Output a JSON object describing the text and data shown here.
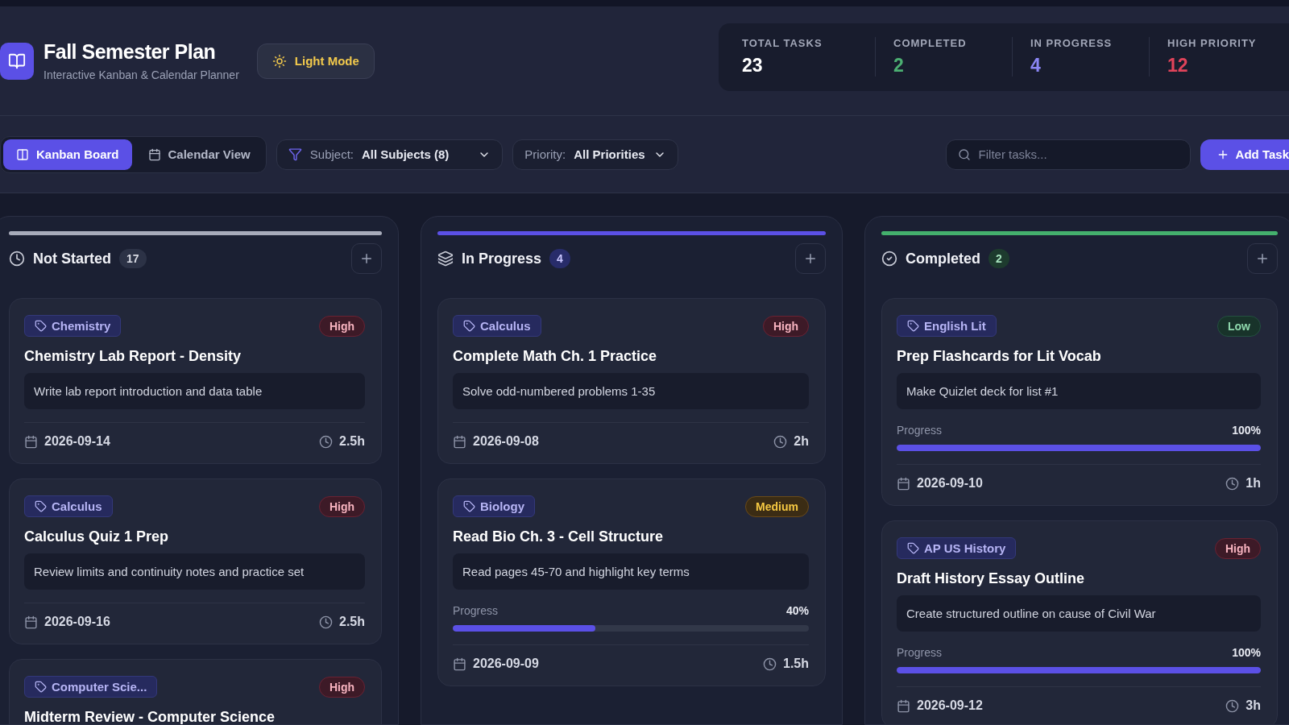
{
  "header": {
    "title": "Fall Semester Plan",
    "subtitle": "Interactive Kanban & Calendar Planner",
    "theme_button": "Light Mode"
  },
  "stats": [
    {
      "label": "TOTAL TASKS",
      "value": "23",
      "kind": "total"
    },
    {
      "label": "COMPLETED",
      "value": "2",
      "kind": "completed"
    },
    {
      "label": "IN PROGRESS",
      "value": "4",
      "kind": "progress"
    },
    {
      "label": "HIGH PRIORITY",
      "value": "12",
      "kind": "high"
    }
  ],
  "views": [
    {
      "label": "Kanban Board",
      "kind": "kanban",
      "selected": true
    },
    {
      "label": "Calendar View",
      "kind": "calendar",
      "selected": false
    }
  ],
  "filters": [
    {
      "label": "Subject:",
      "value": "All Subjects (8)",
      "kind": "subject"
    },
    {
      "label": "Priority:",
      "value": "All Priorities",
      "kind": "priority"
    }
  ],
  "search": {
    "placeholder": "Filter tasks..."
  },
  "add_button": "Add Task",
  "columns": [
    {
      "title": "Not Started",
      "count": "17",
      "kind": "not_started",
      "tasks": [
        {
          "subject": "Chemistry",
          "priority": "High",
          "kind": "high",
          "title": "Chemistry Lab Report - Density",
          "description": "Write lab report introduction and data table",
          "date": "2026-09-14",
          "duration": "2.5h"
        },
        {
          "subject": "Calculus",
          "priority": "High",
          "kind": "high",
          "title": "Calculus Quiz 1 Prep",
          "description": "Review limits and continuity notes and practice set",
          "date": "2026-09-16",
          "duration": "2.5h"
        },
        {
          "subject": "Computer Scie...",
          "priority": "High",
          "kind": "high",
          "title": "Midterm Review - Computer Science"
        }
      ]
    },
    {
      "title": "In Progress",
      "count": "4",
      "kind": "in_progress",
      "tasks": [
        {
          "subject": "Calculus",
          "priority": "High",
          "kind": "high",
          "title": "Complete Math Ch. 1 Practice",
          "description": "Solve odd-numbered problems 1-35",
          "date": "2026-09-08",
          "duration": "2h"
        },
        {
          "subject": "Biology",
          "priority": "Medium",
          "kind": "medium",
          "title": "Read Bio Ch. 3 - Cell Structure",
          "description": "Read pages 45-70 and highlight key terms",
          "progress_label": "Progress",
          "progress_reading": "40%",
          "level": 0.4,
          "date": "2026-09-09",
          "duration": "1.5h"
        }
      ]
    },
    {
      "title": "Completed",
      "count": "2",
      "kind": "completed",
      "tasks": [
        {
          "subject": "English Lit",
          "priority": "Low",
          "kind": "low",
          "title": "Prep Flashcards for Lit Vocab",
          "description": "Make Quizlet deck for list #1",
          "progress_label": "Progress",
          "progress_reading": "100%",
          "level": 1,
          "date": "2026-09-10",
          "duration": "1h"
        },
        {
          "subject": "AP US History",
          "priority": "High",
          "kind": "high",
          "title": "Draft History Essay Outline",
          "description": "Create structured outline on cause of Civil War",
          "progress_label": "Progress",
          "progress_reading": "100%",
          "level": 1,
          "date": "2026-09-12",
          "duration": "3h"
        }
      ]
    }
  ]
}
